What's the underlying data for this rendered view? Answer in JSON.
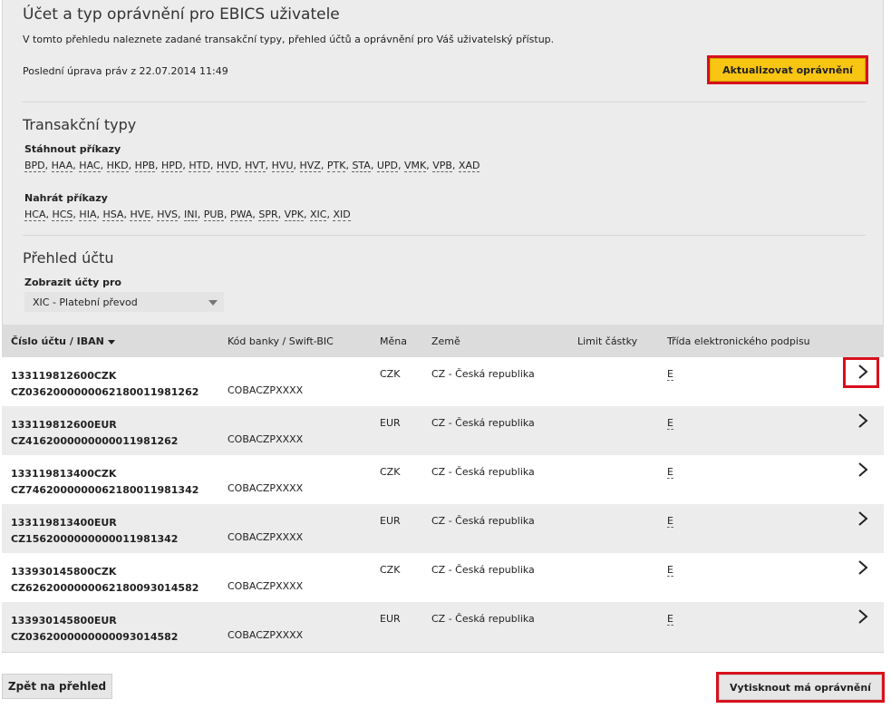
{
  "header": {
    "title": "Účet a typ oprávnění pro EBICS uživatele",
    "intro": "V tomto přehledu naleznete zadané transakční typy, přehled účtů a oprávnění pro Váš uživatelský přístup.",
    "last_modified": "Poslední úprava práv z 22.07.2014 11:49",
    "update_button": "Aktualizovat oprávnění"
  },
  "transaction_types": {
    "title": "Transakční typy",
    "download_label": "Stáhnout příkazy",
    "download_codes": [
      "BPD",
      "HAA",
      "HAC",
      "HKD",
      "HPB",
      "HPD",
      "HTD",
      "HVD",
      "HVT",
      "HVU",
      "HVZ",
      "PTK",
      "STA",
      "UPD",
      "VMK",
      "VPB",
      "XAD"
    ],
    "upload_label": "Nahrát příkazy",
    "upload_codes": [
      "HCA",
      "HCS",
      "HIA",
      "HSA",
      "HVE",
      "HVS",
      "INI",
      "PUB",
      "PWA",
      "SPR",
      "VPK",
      "XIC",
      "XID"
    ]
  },
  "account_overview": {
    "title": "Přehled účtu",
    "filter_label": "Zobrazit účty pro",
    "filter_selected": "XIC - Platební převod"
  },
  "table": {
    "columns": [
      "Číslo účtu / IBAN",
      "Kód banky / Swift-BIC",
      "Měna",
      "Země",
      "Limit částky",
      "Třída elektronického podpisu"
    ],
    "rows": [
      {
        "account": "133119812600CZK",
        "iban": "CZ0362000000062180011981262",
        "bic": "COBACZPXXXX",
        "currency": "CZK",
        "country": "CZ - Česká republika",
        "limit": "",
        "signature": "E"
      },
      {
        "account": "133119812600EUR",
        "iban": "CZ4162000000000011981262",
        "bic": "COBACZPXXXX",
        "currency": "EUR",
        "country": "CZ - Česká republika",
        "limit": "",
        "signature": "E"
      },
      {
        "account": "133119813400CZK",
        "iban": "CZ7462000000062180011981342",
        "bic": "COBACZPXXXX",
        "currency": "CZK",
        "country": "CZ - Česká republika",
        "limit": "",
        "signature": "E"
      },
      {
        "account": "133119813400EUR",
        "iban": "CZ1562000000000011981342",
        "bic": "COBACZPXXXX",
        "currency": "EUR",
        "country": "CZ - Česká republika",
        "limit": "",
        "signature": "E"
      },
      {
        "account": "133930145800CZK",
        "iban": "CZ6262000000062180093014582",
        "bic": "COBACZPXXXX",
        "currency": "CZK",
        "country": "CZ - Česká republika",
        "limit": "",
        "signature": "E"
      },
      {
        "account": "133930145800EUR",
        "iban": "CZ0362000000000093014582",
        "bic": "COBACZPXXXX",
        "currency": "EUR",
        "country": "CZ - Česká republika",
        "limit": "",
        "signature": "E"
      }
    ]
  },
  "footer": {
    "back_button": "Zpět na přehled",
    "print_button": "Vytisknout má oprávnění"
  },
  "colors": {
    "accent_button": "#f9c513",
    "highlight_box": "#d8101c",
    "panel_bg": "#ececec"
  },
  "icons": {
    "row_action": "chevron-right-icon",
    "filter_select": "caret-down-icon",
    "sort": "sort-desc-icon"
  }
}
